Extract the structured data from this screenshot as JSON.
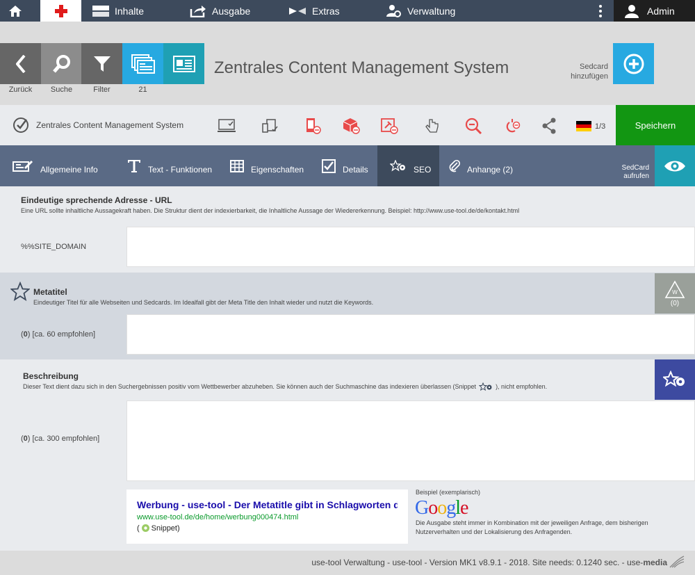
{
  "topnav": {
    "items": [
      {
        "label": "Inhalte"
      },
      {
        "label": "Ausgabe"
      },
      {
        "label": "Extras"
      },
      {
        "label": "Verwaltung"
      }
    ],
    "user": "Admin"
  },
  "toolbar": {
    "back_label": "Zurück",
    "search_label": "Suche",
    "filter_label": "Filter",
    "count_label": "21",
    "title": "Zentrales Content Management System",
    "add_label_line1": "Sedcard",
    "add_label_line2": "hinzufügen"
  },
  "statusbar": {
    "crumb": "Zentrales Content Management System",
    "lang_count": "1/3",
    "save_label": "Speichern"
  },
  "tabs": [
    {
      "label": "Allgemeine Info"
    },
    {
      "label": "Text - Funktionen"
    },
    {
      "label": "Eigenschaften"
    },
    {
      "label": "Details"
    },
    {
      "label": "SEO"
    },
    {
      "label": "Anhange (2)"
    }
  ],
  "sedcard_view": {
    "line1": "SedCard",
    "line2": "aufrufen"
  },
  "url_section": {
    "title": "Eindeutige sprechende Adresse - URL",
    "desc": "Eine URL sollte inhaltliche Aussagekraft haben. Die Struktur dient der indexierbarkeit, die Inhaltliche Aussage der Wiedererkennung. Beispiel: http://www.use-tool.de/de/kontakt.html",
    "prefix": "%%SITE_DOMAIN",
    "value": ""
  },
  "meta_section": {
    "title": "Metatitel",
    "desc": "Eindeutiger Titel für alle Webseiten und Sedcards. Im Idealfall gibt der Meta Title den Inhalt wieder und nutzt die Keywords.",
    "count": "0",
    "hint": "[ca. 60 empfohlen]",
    "badge": "(0)",
    "value": ""
  },
  "desc_section": {
    "title": "Beschreibung",
    "desc_before": "Dieser Text dient dazu sich in den Suchergebnissen positiv vom Wettbewerber abzuheben. Sie können auch der Suchmaschine das indexieren überlassen (Snippet",
    "desc_after": "), nicht empfohlen.",
    "count": "0",
    "hint": "[ca. 300 empfohlen]",
    "value": ""
  },
  "snippet": {
    "title": "Werbung - use-tool - Der Metatitle gibt in Schlagworten den ..",
    "url": "www.use-tool.de/de/home/werbung000474.html",
    "snippet_open": "(",
    "snippet_label": "Snippet)"
  },
  "example": {
    "label": "Beispiel (exemplarisch)",
    "google_letters": [
      "G",
      "o",
      "o",
      "g",
      "l",
      "e"
    ],
    "desc": "Die Ausgabe steht immer in Kombination mit der jeweiligen Anfrage, dem bisherigen Nutzerverhalten und der Lokalisierung des Anfragenden."
  },
  "footer": {
    "text": "use-tool Verwaltung - use-tool - Version MK1 v8.9.1 - 2018. Site needs: 0.1240 sec. - use-",
    "brand": "media"
  },
  "colors": {
    "topnav": "#3d4a5c",
    "tabs": "#5a6a85",
    "save": "#129612",
    "add": "#27a9e1",
    "eye": "#1fa0b4",
    "seo_badge": "#3d4aa0",
    "meta_badge": "#9aa09a",
    "google": [
      "#3369e8",
      "#d50f25",
      "#eeb211",
      "#3369e8",
      "#009925",
      "#d50f25"
    ]
  }
}
